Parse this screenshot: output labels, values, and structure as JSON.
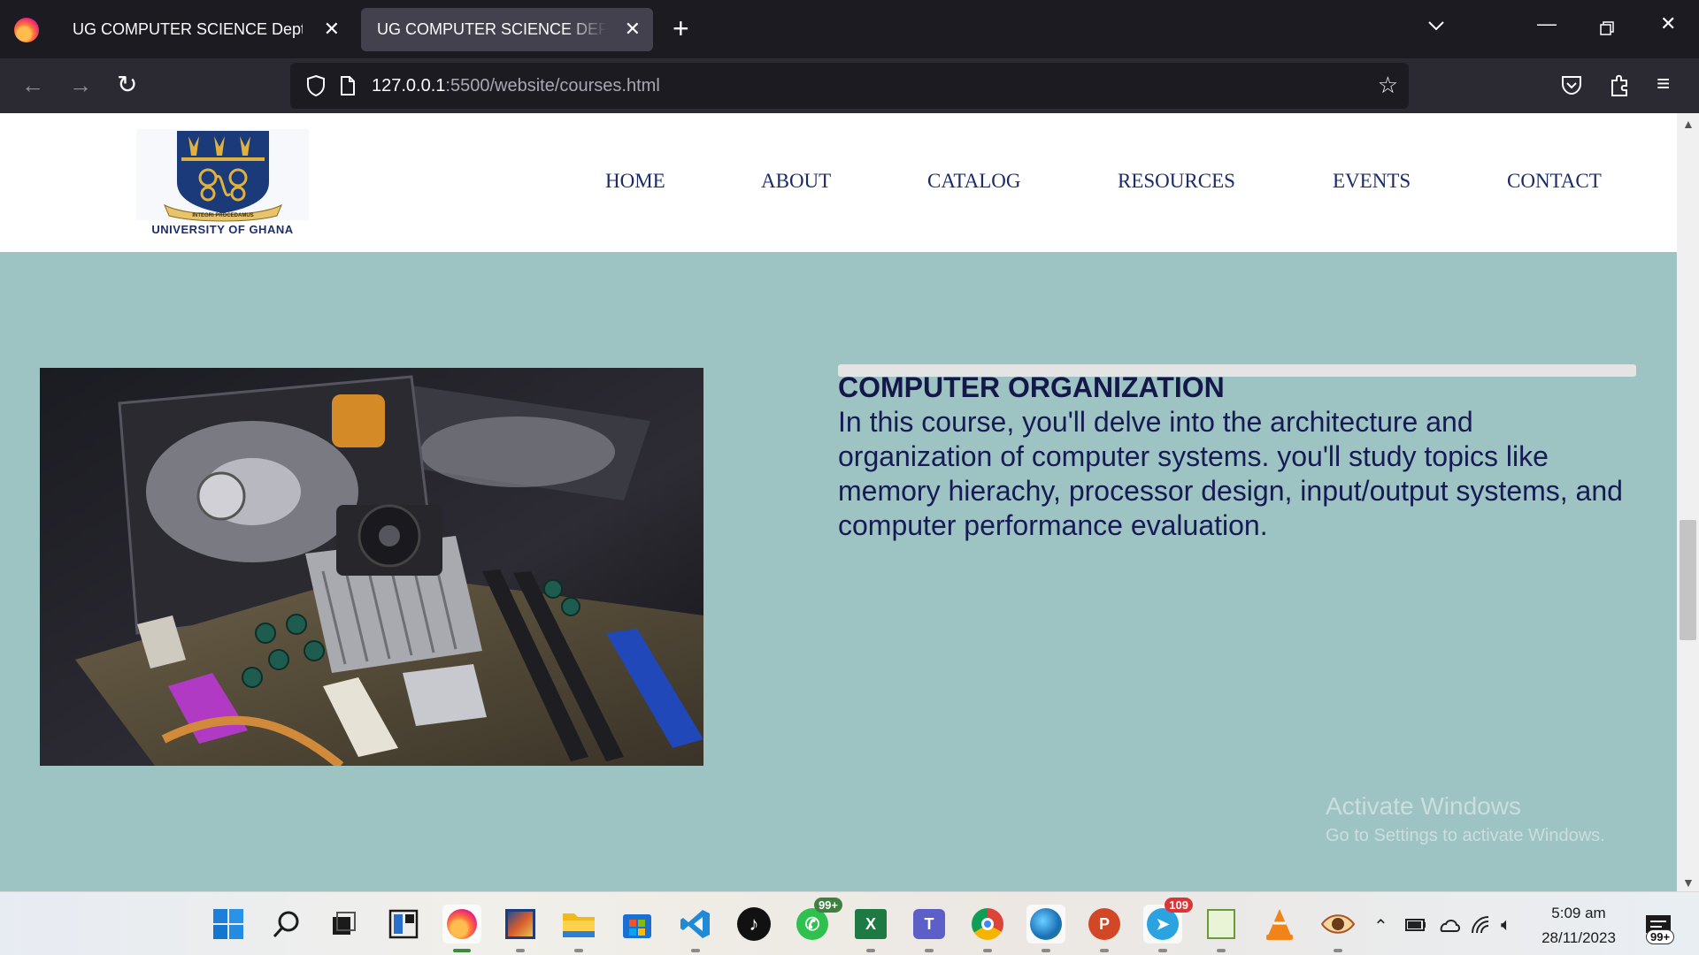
{
  "browser": {
    "tabs": [
      {
        "title": "UG COMPUTER SCIENCE Dept.",
        "active": false
      },
      {
        "title": "UG COMPUTER SCIENCE DEPARTMENT",
        "active": true
      }
    ],
    "url_host": "127.0.0.1",
    "url_path": ":5500/website/courses.html"
  },
  "site": {
    "logo_text": "UNIVERSITY OF GHANA",
    "logo_motto": "INTEGRI PROCEDAMUS",
    "nav": [
      "HOME",
      "ABOUT",
      "CATALOG",
      "RESOURCES",
      "EVENTS",
      "CONTACT"
    ]
  },
  "course": {
    "title": "COMPUTER ORGANIZATION",
    "description": "In this course, you'll delve into the architecture and organization of computer systems. you'll study topics like memory hierachy, processor design, input/output systems, and computer performance evaluation."
  },
  "watermark": {
    "line1": "Activate Windows",
    "line2": "Go to Settings to activate Windows."
  },
  "taskbar": {
    "time": "5:09 am",
    "date": "28/11/2023",
    "whatsapp_badge": "99+",
    "telegram_badge": "109",
    "notifications_badge": "99+",
    "icons": [
      "windows-start",
      "search",
      "task-view",
      "widgets",
      "firefox",
      "photo-app",
      "file-explorer",
      "microsoft-store",
      "vscode",
      "tiktok",
      "whatsapp",
      "excel",
      "teams",
      "chrome",
      "internet-download-manager",
      "powerpoint",
      "telegram",
      "notepad",
      "vlc",
      "eye-app"
    ]
  }
}
